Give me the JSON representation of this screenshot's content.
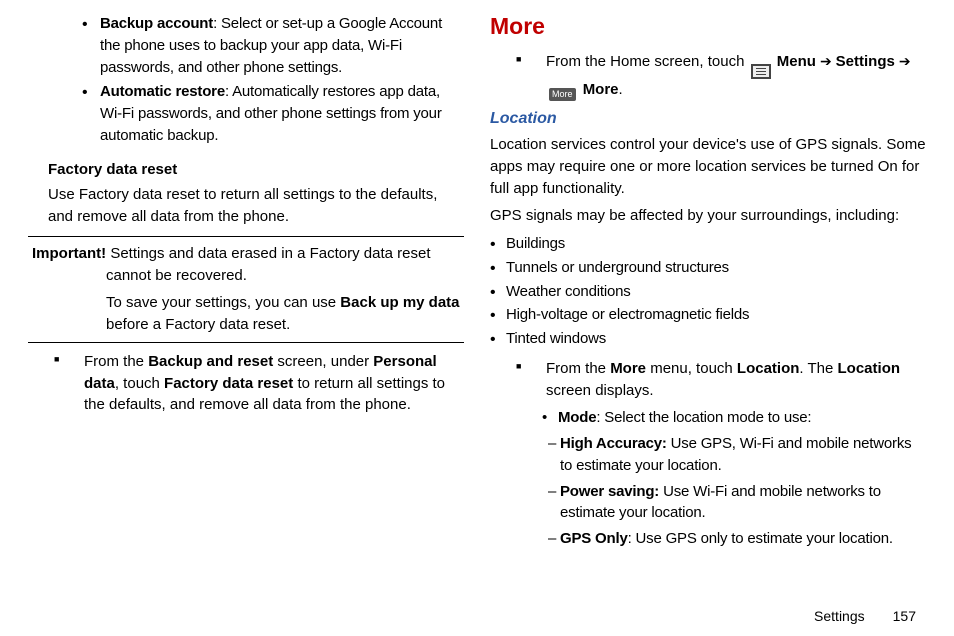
{
  "left": {
    "backup_account": {
      "t": "Backup account",
      "d": ": Select or set-up a Google Account the phone uses to backup your app data, Wi-Fi passwords, and other phone settings."
    },
    "auto_restore": {
      "t": "Automatic restore",
      "d": ": Automatically restores app data, Wi-Fi passwords, and other phone settings from your automatic backup."
    },
    "fdr_title": "Factory data reset",
    "fdr_p": "Use Factory data reset to return all settings to the defaults, and remove all data from the phone.",
    "imp_label": "Important! ",
    "imp_l1": "Settings and data erased in a Factory data reset cannot be recovered.",
    "imp_l2a": "To save your settings, you can use ",
    "imp_l2b": "Back up my data",
    "imp_l2c": " before a Factory data reset.",
    "step_a": "From the ",
    "step_b": "Backup and reset",
    "step_c": " screen, under ",
    "step_d": "Personal data",
    "step_e": ", touch ",
    "step_f": "Factory data reset",
    "step_g": " to return all settings to the defaults, and remove all data from the phone."
  },
  "right": {
    "more": "More",
    "nav_a": "From the Home screen, touch ",
    "nav_menu": "Menu",
    "nav_b": "Settings",
    "nav_more": "More",
    "period": ".",
    "loc_title": "Location",
    "loc_p1": "Location services control your device's use of GPS signals. Some apps may require one or more location services be turned On for full app functionality.",
    "loc_p2": "GPS signals may be affected by your surroundings, including:",
    "gps": [
      "Buildings",
      "Tunnels or underground structures",
      "Weather conditions",
      "High-voltage or electromagnetic fields",
      "Tinted windows"
    ],
    "step2_a": "From the ",
    "step2_b": "More",
    "step2_c": " menu, touch ",
    "step2_d": "Location",
    "step2_e": ". The ",
    "step2_f": "Location",
    "step2_g": " screen displays.",
    "mode_t": "Mode",
    "mode_d": ": Select the location mode to use:",
    "ha_t": "High Accuracy: ",
    "ha_d": "Use GPS, Wi-Fi and mobile networks to estimate your location.",
    "ps_t": "Power saving: ",
    "ps_d": "Use Wi-Fi and mobile networks to estimate your location.",
    "go_t": "GPS Only",
    "go_d": ": Use GPS only to estimate your location."
  },
  "footer": {
    "chapter": "Settings",
    "page": "157"
  },
  "icons": {
    "more": "More"
  }
}
